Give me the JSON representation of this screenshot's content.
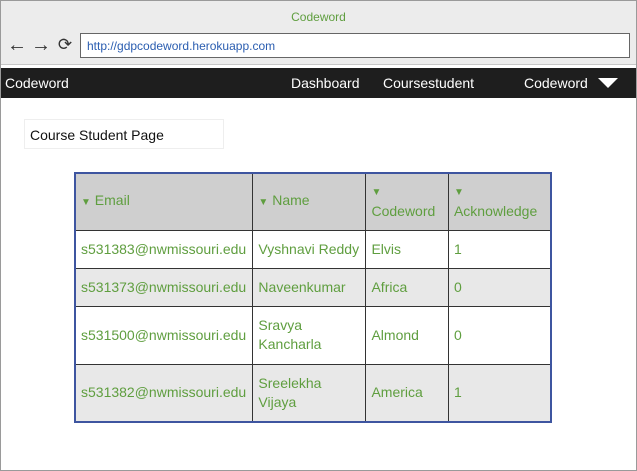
{
  "window": {
    "title": "Codeword"
  },
  "browser": {
    "url": "http://gdpcodeword.herokuapp.com"
  },
  "navbar": {
    "brand": "Codeword",
    "links": {
      "dashboard": "Dashboard",
      "courses": "Coursestudent",
      "user": "Codeword"
    }
  },
  "page": {
    "heading": "Course Student Page"
  },
  "table": {
    "headers": {
      "email": "Email",
      "name": "Name",
      "codeword": "Codeword",
      "acknowledge": "Acknowledge"
    },
    "rows": [
      {
        "email": "s531383@nwmissouri.edu",
        "name": "Vyshnavi Reddy",
        "codeword": "Elvis",
        "acknowledge": "1"
      },
      {
        "email": "s531373@nwmissouri.edu",
        "name": "Naveenkumar",
        "codeword": "Africa",
        "acknowledge": "0"
      },
      {
        "email": "s531500@nwmissouri.edu",
        "name": "Sravya Kancharla",
        "codeword": "Almond",
        "acknowledge": "0"
      },
      {
        "email": "s531382@nwmissouri.edu",
        "name": "Sreelekha Vijaya",
        "codeword": "America",
        "acknowledge": "1"
      }
    ]
  },
  "colors": {
    "accent_text": "#5f9e3f",
    "table_border": "#3e55a0",
    "navbar_bg": "#1e1e1e",
    "header_bg": "#cfcfcf",
    "row_alt_bg": "#e8e8e8"
  },
  "icons": {
    "back": "arrow-left-icon",
    "forward": "arrow-right-icon",
    "reload": "reload-icon",
    "dropdown": "caret-down-icon",
    "sort": "sort-down-icon"
  }
}
